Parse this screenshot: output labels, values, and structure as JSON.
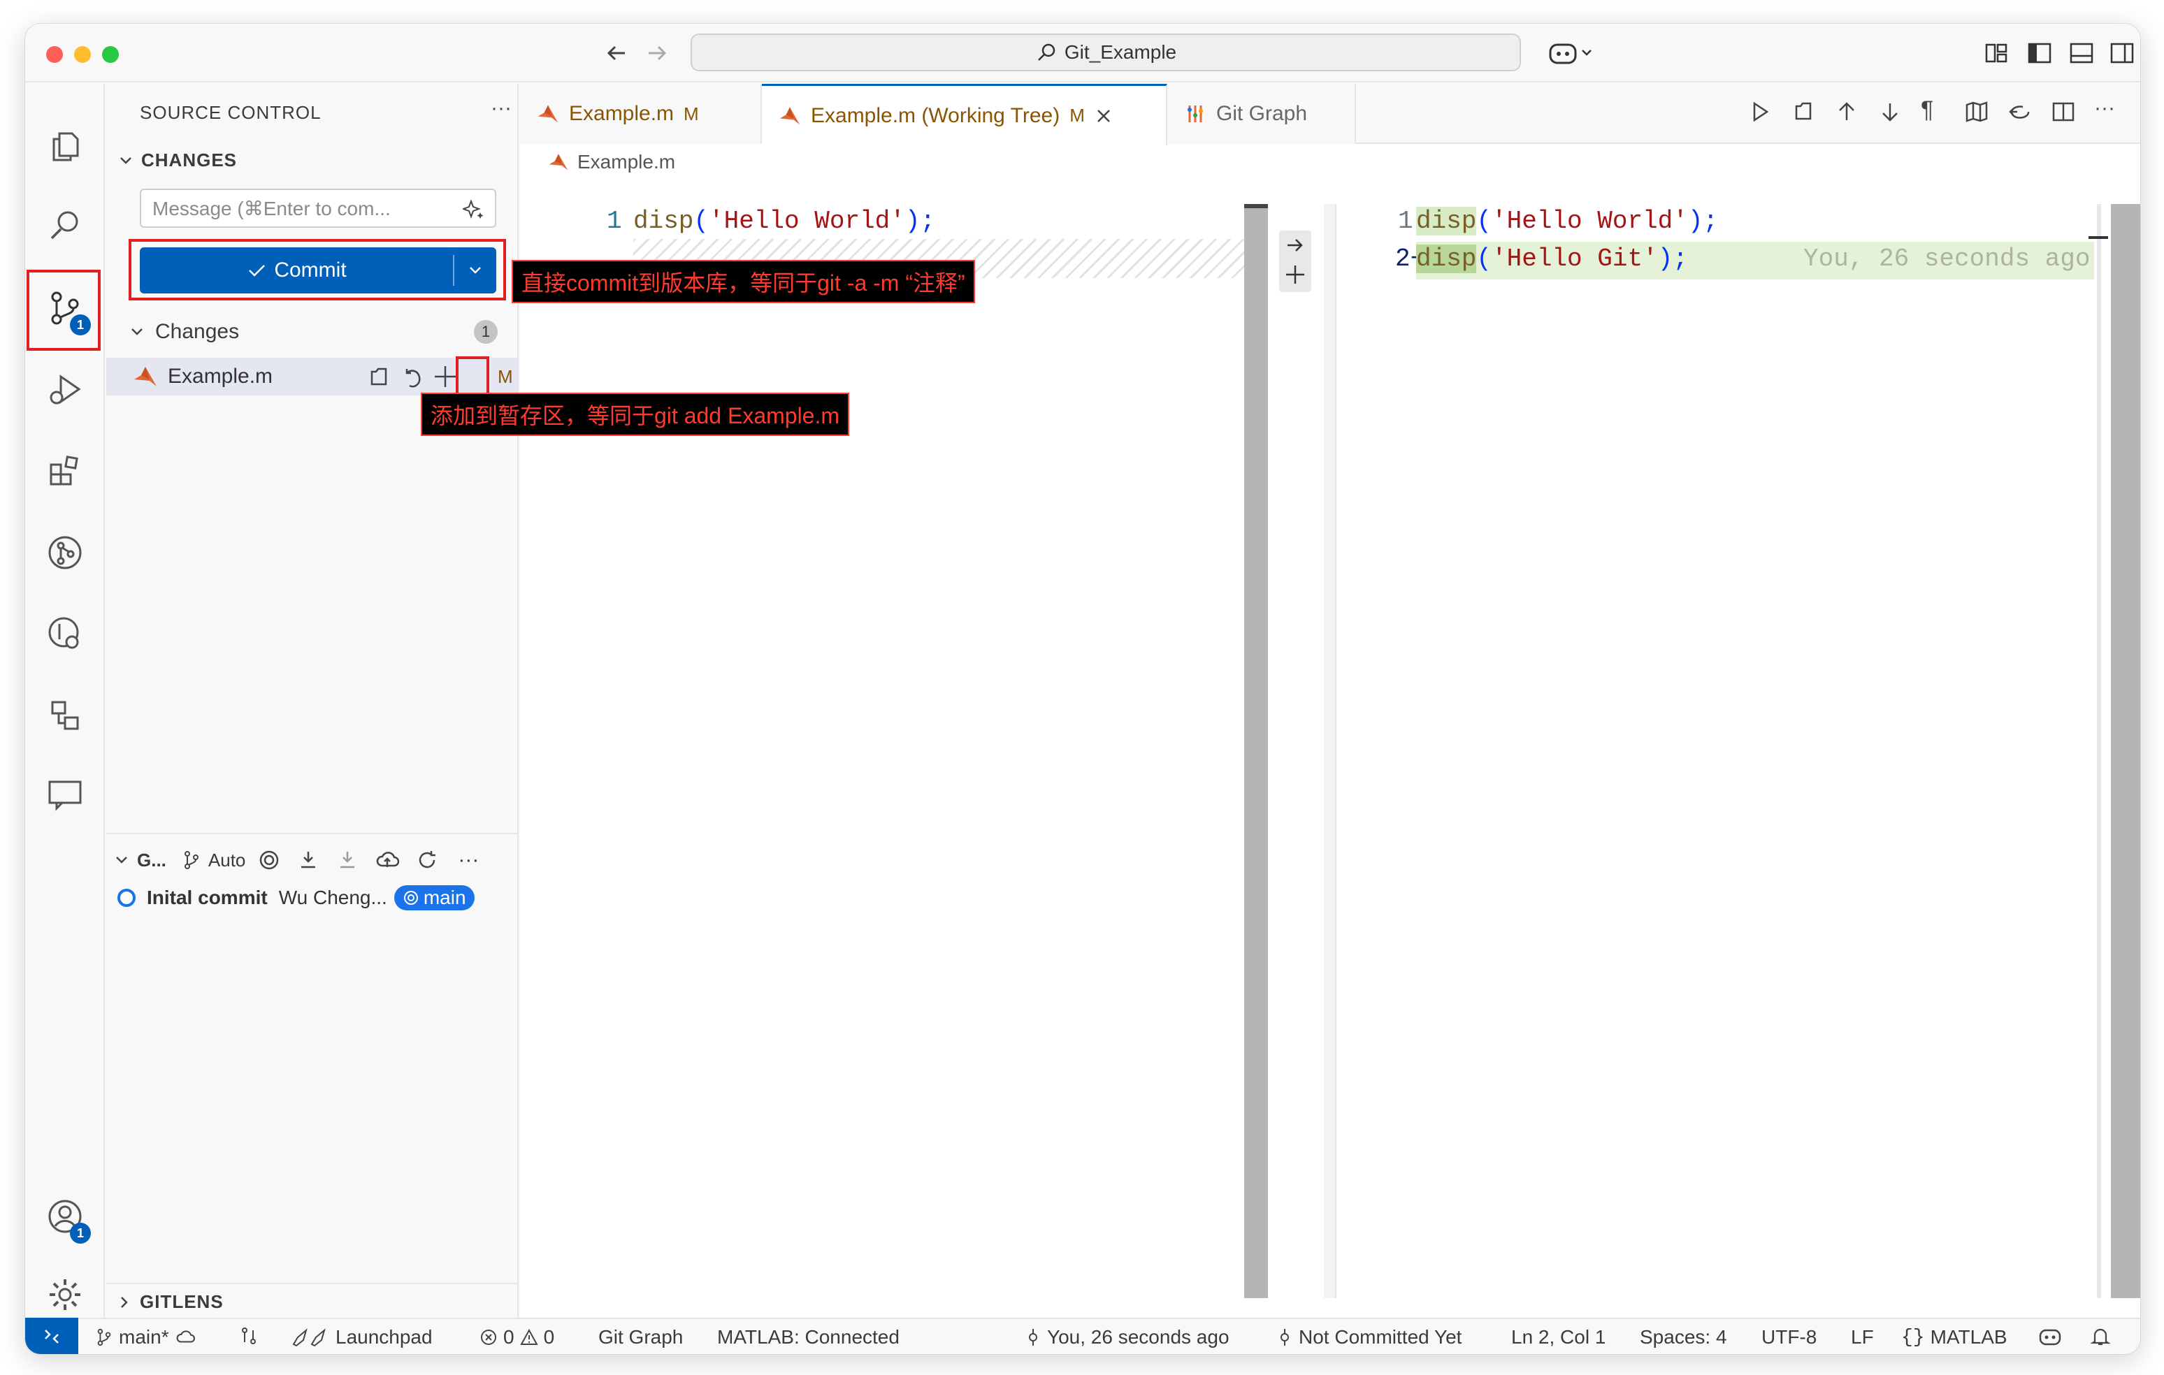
{
  "window": {
    "title": "Git_Example"
  },
  "sidebar": {
    "title": "SOURCE CONTROL",
    "more": "···",
    "changes_header": "CHANGES",
    "message_placeholder": "Message (⌘Enter to com...",
    "commit_label": "Commit",
    "changes_group": "Changes",
    "changes_count": "1",
    "file_name": "Example.m",
    "file_status": "M",
    "graph_header": "G...",
    "graph_auto": "Auto",
    "commit_message": "Inital commit",
    "commit_author": "Wu Cheng...",
    "branch": "main",
    "gitlens": "GITLENS"
  },
  "activity_badges": {
    "scm": "1",
    "accounts": "1"
  },
  "tabs": [
    {
      "label": "Example.m",
      "status": "M"
    },
    {
      "label": "Example.m (Working Tree)",
      "status": "M"
    },
    {
      "label": "Git Graph"
    }
  ],
  "breadcrumb": "Example.m",
  "left_editor": {
    "line1_no": "1",
    "line1_fn": "disp",
    "line1_open": "(",
    "line1_str": "'Hello World'",
    "line1_close": ");"
  },
  "right_editor": {
    "line1_no": "1",
    "line1_fn": "disp",
    "line1_open": "(",
    "line1_str": "'Hello World'",
    "line1_close": ");",
    "line2_no": "2+",
    "line2_fn": "disp",
    "line2_open": "(",
    "line2_str": "'Hello Git'",
    "line2_close": ");",
    "blame": "You, 26 seconds ago"
  },
  "annotations": {
    "commit_note": "直接commit到版本库，等同于git -a -m “注释”",
    "add_note": "添加到暂存区，等同于git add Example.m"
  },
  "status": {
    "branch": "main*",
    "launchpad": "Launchpad",
    "errors": "0",
    "warnings": "0",
    "git_graph": "Git Graph",
    "matlab": "MATLAB: Connected",
    "blame": "You, 26 seconds ago",
    "not_committed": "Not Committed Yet",
    "position": "Ln 2, Col 1",
    "spaces": "Spaces: 4",
    "encoding": "UTF-8",
    "eol": "LF",
    "language": "MATLAB"
  },
  "colors": {
    "accent": "#005fb8",
    "annotation": "#ff3b30",
    "modified": "#895503",
    "string": "#a31515",
    "function": "#795e26",
    "linenum": "#237893"
  }
}
